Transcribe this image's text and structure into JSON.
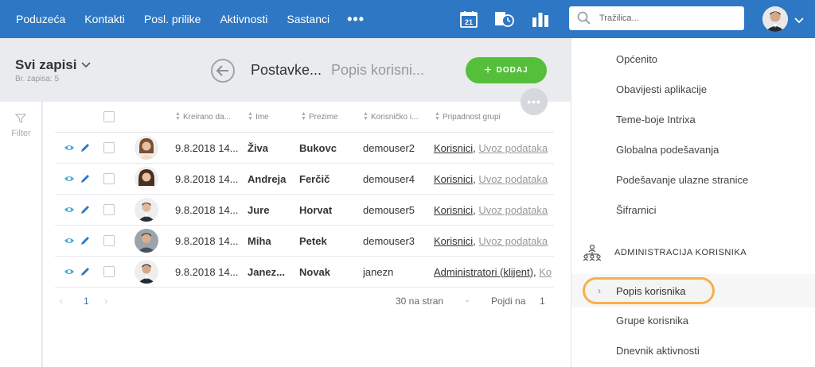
{
  "topnav": {
    "items": [
      "Poduzeća",
      "Kontakti",
      "Posl. prilike",
      "Aktivnosti",
      "Sastanci"
    ],
    "more": "•••",
    "calendar_day": "21",
    "search_placeholder": "Tražilica..."
  },
  "toolbar": {
    "view_title": "Svi zapisi",
    "record_count": "Br. zapisa: 5",
    "page_title": "Postavke...",
    "page_subtitle": "Popis korisni...",
    "add_label": "DODAJ",
    "add_icon": "+",
    "more_label": "•••"
  },
  "filter": {
    "label": "Filter"
  },
  "grid": {
    "headers": [
      "Kreirano da...",
      "Ime",
      "Prezime",
      "Korisničko i...",
      "Pripadnost grupi"
    ],
    "rows": [
      {
        "created": "9.8.2018 14...",
        "first": "Živa",
        "last": "Bukovc",
        "username": "demouser2",
        "group1": "Korisnici",
        "sep": ",",
        "group2": "Uvoz podataka",
        "group_rest": ""
      },
      {
        "created": "9.8.2018 14...",
        "first": "Andreja",
        "last": "Ferčič",
        "username": "demouser4",
        "group1": "Korisnici",
        "sep": ",",
        "group2": "Uvoz podataka",
        "group_rest": ""
      },
      {
        "created": "9.8.2018 14...",
        "first": "Jure",
        "last": "Horvat",
        "username": "demouser5",
        "group1": "Korisnici",
        "sep": ",",
        "group2": "Uvoz podataka",
        "group_rest": ""
      },
      {
        "created": "9.8.2018 14...",
        "first": "Miha",
        "last": "Petek",
        "username": "demouser3",
        "group1": "Korisnici",
        "sep": ",",
        "group2": "Uvoz podataka",
        "group_rest": ""
      },
      {
        "created": "9.8.2018 14...",
        "first": "Janez...",
        "last": "Novak",
        "username": "janezn",
        "group1": "Administratori (klijent)",
        "sep": ",",
        "group2": "Ko",
        "group_rest": ""
      }
    ]
  },
  "pager": {
    "prev": "‹",
    "page": "1",
    "next": "›",
    "per_page": "30 na stran",
    "per_page_chevron": "⌄",
    "goto_label": "Pojdi na",
    "goto_value": "1"
  },
  "right_panel": {
    "items_top": [
      "Općenito",
      "Obavijesti aplikacije",
      "Teme-boje Intrixa",
      "Globalna podešavanja",
      "Podešavanje ulazne stranice",
      "Šifrarnici"
    ],
    "section_title": "ADMINISTRACIJA KORISNIKA",
    "active_item": "Popis korisnika",
    "active_chevron": "›",
    "items_bottom": [
      "Grupe korisnika",
      "Dnevnik aktivnosti"
    ]
  },
  "colors": {
    "topbar": "#2d77c4",
    "add_button": "#55bf3c",
    "active_outline": "#f5b04c",
    "link_blue": "#2d77c4"
  }
}
